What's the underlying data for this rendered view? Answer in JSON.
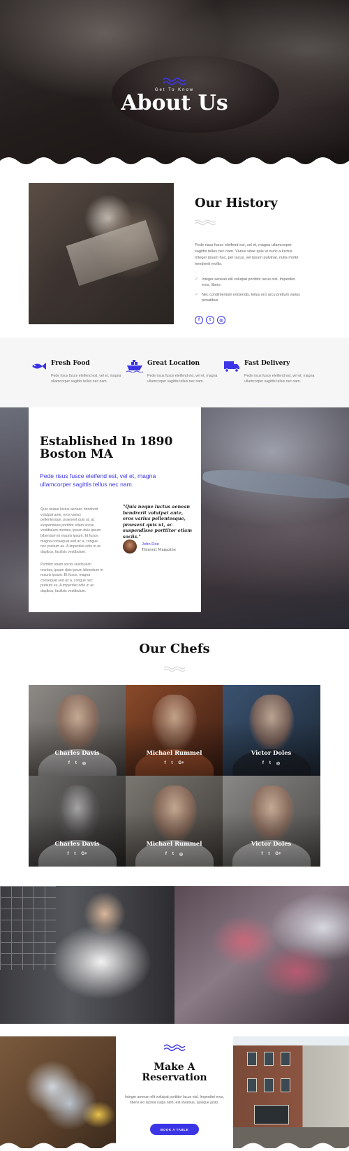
{
  "colors": {
    "accent": "#3c35e6",
    "dark": "#111111",
    "muted": "#777777",
    "band": "#f6f6f6"
  },
  "hero": {
    "subtitle": "Get To Know",
    "title": "About Us",
    "icon": "wave-icon"
  },
  "history": {
    "title": "Our History",
    "paragraph": "Pede risus fusce eleifend est, vel et, magna ullamcorper sagittis tellus nec nam. Varius vitae quis ut nunc a luctus. Integer ipsum hac, per lacus, vel ipsum pulvinar, nulla morbi hendrerit mollis.",
    "list": [
      "Integer aenean elit volutpat porttitor lacus nisl. Imperdiet eros, libero.",
      "Nec condimentum reiciendis, tellus orci arcu pretium varius penatibus."
    ],
    "social": [
      "facebook-icon",
      "twitter-icon",
      "instagram-icon"
    ],
    "social_glyphs": [
      "f",
      "t",
      "◎"
    ]
  },
  "features": [
    {
      "icon": "fish-icon",
      "title": "Fresh Food",
      "text": "Pede risus fusce eleifend est, vel et, magna ullamcorper sagittis tellus nec nam."
    },
    {
      "icon": "ship-icon",
      "title": "Great Location",
      "text": "Pede risus fusce eleifend est, vel et, magna ullamcorper sagittis tellus nec nam."
    },
    {
      "icon": "truck-icon",
      "title": "Fast Delivery",
      "text": "Pede risus fusce eleifend est, vel et, magna ullamcorper sagittis tellus nec nam."
    }
  ],
  "established": {
    "title": "Established In 1890 Boston MA",
    "subtitle": "Pede risus fusce eleifend est, vel et, magna ullamcorper sagittis tellus nec nam.",
    "paragraph1": "Quis neque luctus aenean hendrerit volutpat ante, eros varius pellentesque, praesent quis ut, ac suspendisse porttitor etiam sociis vestibulum montes, ipsum duis ipsum bibendum in mauris ipsum. Et fusce, magna consequat sed ac a, congue nec pretium eu. A imperdiet odio in ac dapibus, facilisis vestibulum.",
    "paragraph2": "Porttitor etiam sociis vestibulum montes, ipsum duis ipsum bibendum in mauris ipsum. Et fusce, magna consequat sed ac a, congue nec pretium eu. A imperdiet odio in ac dapibus, facilisis vestibulum.",
    "quote": "\"Quis neque luctus aenean hendrerit volutpat ante, eros varius pellentesque, praesent quis ut, ac suspendisse porttitor etiam sociis.\"",
    "author": "John Doe",
    "organization": "Timeout Magazine"
  },
  "chefs": {
    "title": "Our Chefs",
    "members": [
      {
        "name": "Charles Davis",
        "social": [
          "f",
          "t",
          "◎"
        ]
      },
      {
        "name": "Michael Rummel",
        "social": [
          "f",
          "t",
          "G+"
        ]
      },
      {
        "name": "Victor Doles",
        "social": [
          "f",
          "t",
          "◎"
        ]
      },
      {
        "name": "Charles Davis",
        "social": [
          "f",
          "t",
          "G+"
        ]
      },
      {
        "name": "Michael Rummel",
        "social": [
          "f",
          "t",
          "◎"
        ]
      },
      {
        "name": "Victor Doles",
        "social": [
          "f",
          "t",
          "G+"
        ]
      }
    ]
  },
  "reservation": {
    "title": "Make A Reservation",
    "text": "Integer aenean elit volutpat porttitor lacus nisl. Imperdiet eros, libero leo lacinia culpa nibh, est vivamus, quisque justo.",
    "button": "BOOK A TABLE"
  }
}
